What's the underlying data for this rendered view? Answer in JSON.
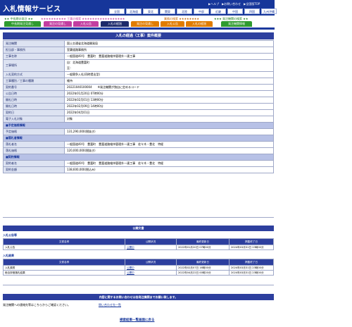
{
  "header": {
    "title": "入札情報サービス",
    "links": [
      "▶ヘルプ",
      "▶お問い合わせ",
      "▶全国版TOP"
    ],
    "regions": [
      "全国",
      "北海道",
      "東北",
      "関東",
      "北陸",
      "中部",
      "近畿",
      "中国",
      "四国",
      "九州沖縄"
    ]
  },
  "sections": {
    "a": "★★ 中長期の発注 ★★",
    "b": "★★★★★★★★★★ 工事の検索 ★★★★★★★★★★★★★★★★★",
    "c": "業務の検索 ★★★★★★★★",
    "d": "★★★ 発注機関の検索 ★★",
    "e": ""
  },
  "tabs": [
    {
      "label": "中長期発注見通し",
      "color": "#2f9b2f"
    },
    {
      "label": "発注の見通し",
      "color": "#c23ea0"
    },
    {
      "label": "入札公告",
      "color": "#c23ea0"
    },
    {
      "label": "入札の経過",
      "color": "#1c2a6a"
    },
    {
      "label": "発注の見通し",
      "color": "#e07c00"
    },
    {
      "label": "入札公告",
      "color": "#e07c00"
    },
    {
      "label": "入札の経過",
      "color": "#e07c00"
    },
    {
      "label": "発注機関情報",
      "color": "#2f9b2f"
    }
  ],
  "main": {
    "title": "入札の経過（工事）案件概要",
    "rows": [
      {
        "k": "発注機関",
        "v": "国土交通省北海道開発局"
      },
      {
        "k": "担当部・事務所",
        "v": "室蘭道路事務所"
      },
      {
        "k": "工事名称",
        "v": "一般国道40号　豊富町　豊富道路維持管理外一連工事"
      },
      {
        "k": "工事場所",
        "v": "自：北海道豊富町\n至："
      },
      {
        "k": "入札契約方式",
        "v": "一般競争入札(同時提出型)"
      },
      {
        "k": "工事種別／工事の種類",
        "v": "維持"
      },
      {
        "k": "契約番号",
        "v": "20221040100004　　※発注機関が独自に定めるコード"
      },
      {
        "k": "公告日時",
        "v": "2022年01月20日 07時00分"
      },
      {
        "k": "開札日時",
        "v": "2022年02月01日 13時00分"
      },
      {
        "k": "開札日時",
        "v": "2022年02月09日 14時00分"
      },
      {
        "k": "契約日",
        "v": "2022年04月01日"
      },
      {
        "k": "電子入札対象",
        "v": "対象"
      }
    ],
    "section_plan": "■予定価格情報",
    "plan_rows": [
      {
        "k": "予定価格",
        "v": "131,290,000(税抜き)"
      }
    ],
    "section_bid": "■落札者情報",
    "bid_rows": [
      {
        "k": "落札者名",
        "v": "一般国道40号　豊富町　豊富道路維持管理外一連工事　佐々木・豊北　特経"
      },
      {
        "k": "落札価格",
        "v": "120,000,000(税抜き)"
      }
    ],
    "section_contract": "■契約情報",
    "contract_rows": [
      {
        "k": "契約者名",
        "v": "一般国道40号　豊富町　豊富道路維持管理外一連工事　佐々木・豊北　特経"
      },
      {
        "k": "契約金額",
        "v": "138,600,000(税込み)"
      }
    ]
  },
  "public_docs": {
    "title": "公開文書",
    "notice_group": "入札公告等",
    "result_group": "入札結果",
    "headers": [
      "文書名称",
      "公開状況",
      "最終更新日",
      "掲載終了日"
    ],
    "notice_rows": [
      {
        "name": "入札公告",
        "status": "公開中",
        "updated": "2022年01月20日 07時00分",
        "end": "2024年03月31日 23時00分"
      }
    ],
    "result_rows": [
      {
        "name": "入札調書",
        "status": "公開中",
        "updated": "2022年02月07日 16時00分",
        "end": "2024年03月31日 23時00分"
      },
      {
        "name": "総合評価落札結果",
        "status": "公開中",
        "updated": "2022年04月22日 00時20分",
        "end": "2024年03月31日 23時00分"
      }
    ]
  },
  "footer": {
    "notice": "内容に関するお問い合わせは各発注機関までお願い致します。",
    "left": "発注機関への連絡先等はこちらからご確認ください。",
    "right": "問い合わせ先一覧",
    "back": "検索結果一覧画面に戻る"
  }
}
